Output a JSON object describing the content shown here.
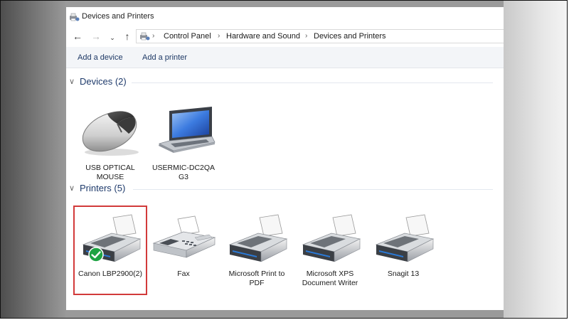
{
  "window": {
    "title": "Devices and Printers",
    "title_icon": "devices-printers-icon"
  },
  "navigation": {
    "back_icon": "arrow-left-icon",
    "forward_icon": "arrow-right-icon",
    "recent_icon": "chevron-down-icon",
    "up_icon": "arrow-up-icon"
  },
  "breadcrumb": {
    "items": [
      "Control Panel",
      "Hardware and Sound",
      "Devices and Printers"
    ],
    "separator": "›"
  },
  "toolbar": {
    "add_device": "Add a device",
    "add_printer": "Add a printer"
  },
  "devices": {
    "header": "Devices (2)",
    "items": [
      {
        "label": "USB OPTICAL MOUSE",
        "icon": "mouse-icon"
      },
      {
        "label": "USERMIC-DC2QA G3",
        "icon": "laptop-icon"
      }
    ]
  },
  "printers": {
    "header": "Printers (5)",
    "items": [
      {
        "label": "Canon LBP2900(2)",
        "icon": "printer-icon",
        "default": true
      },
      {
        "label": "Fax",
        "icon": "fax-icon"
      },
      {
        "label": "Microsoft Print to PDF",
        "icon": "printer-icon"
      },
      {
        "label": "Microsoft XPS Document Writer",
        "icon": "printer-icon"
      },
      {
        "label": "Snagit 13",
        "icon": "printer-icon"
      }
    ]
  },
  "colors": {
    "group_title": "#1e3a6b",
    "toolbar_text": "#1e3965",
    "highlight_border": "#d23a3a",
    "default_check": "#1ea343"
  }
}
